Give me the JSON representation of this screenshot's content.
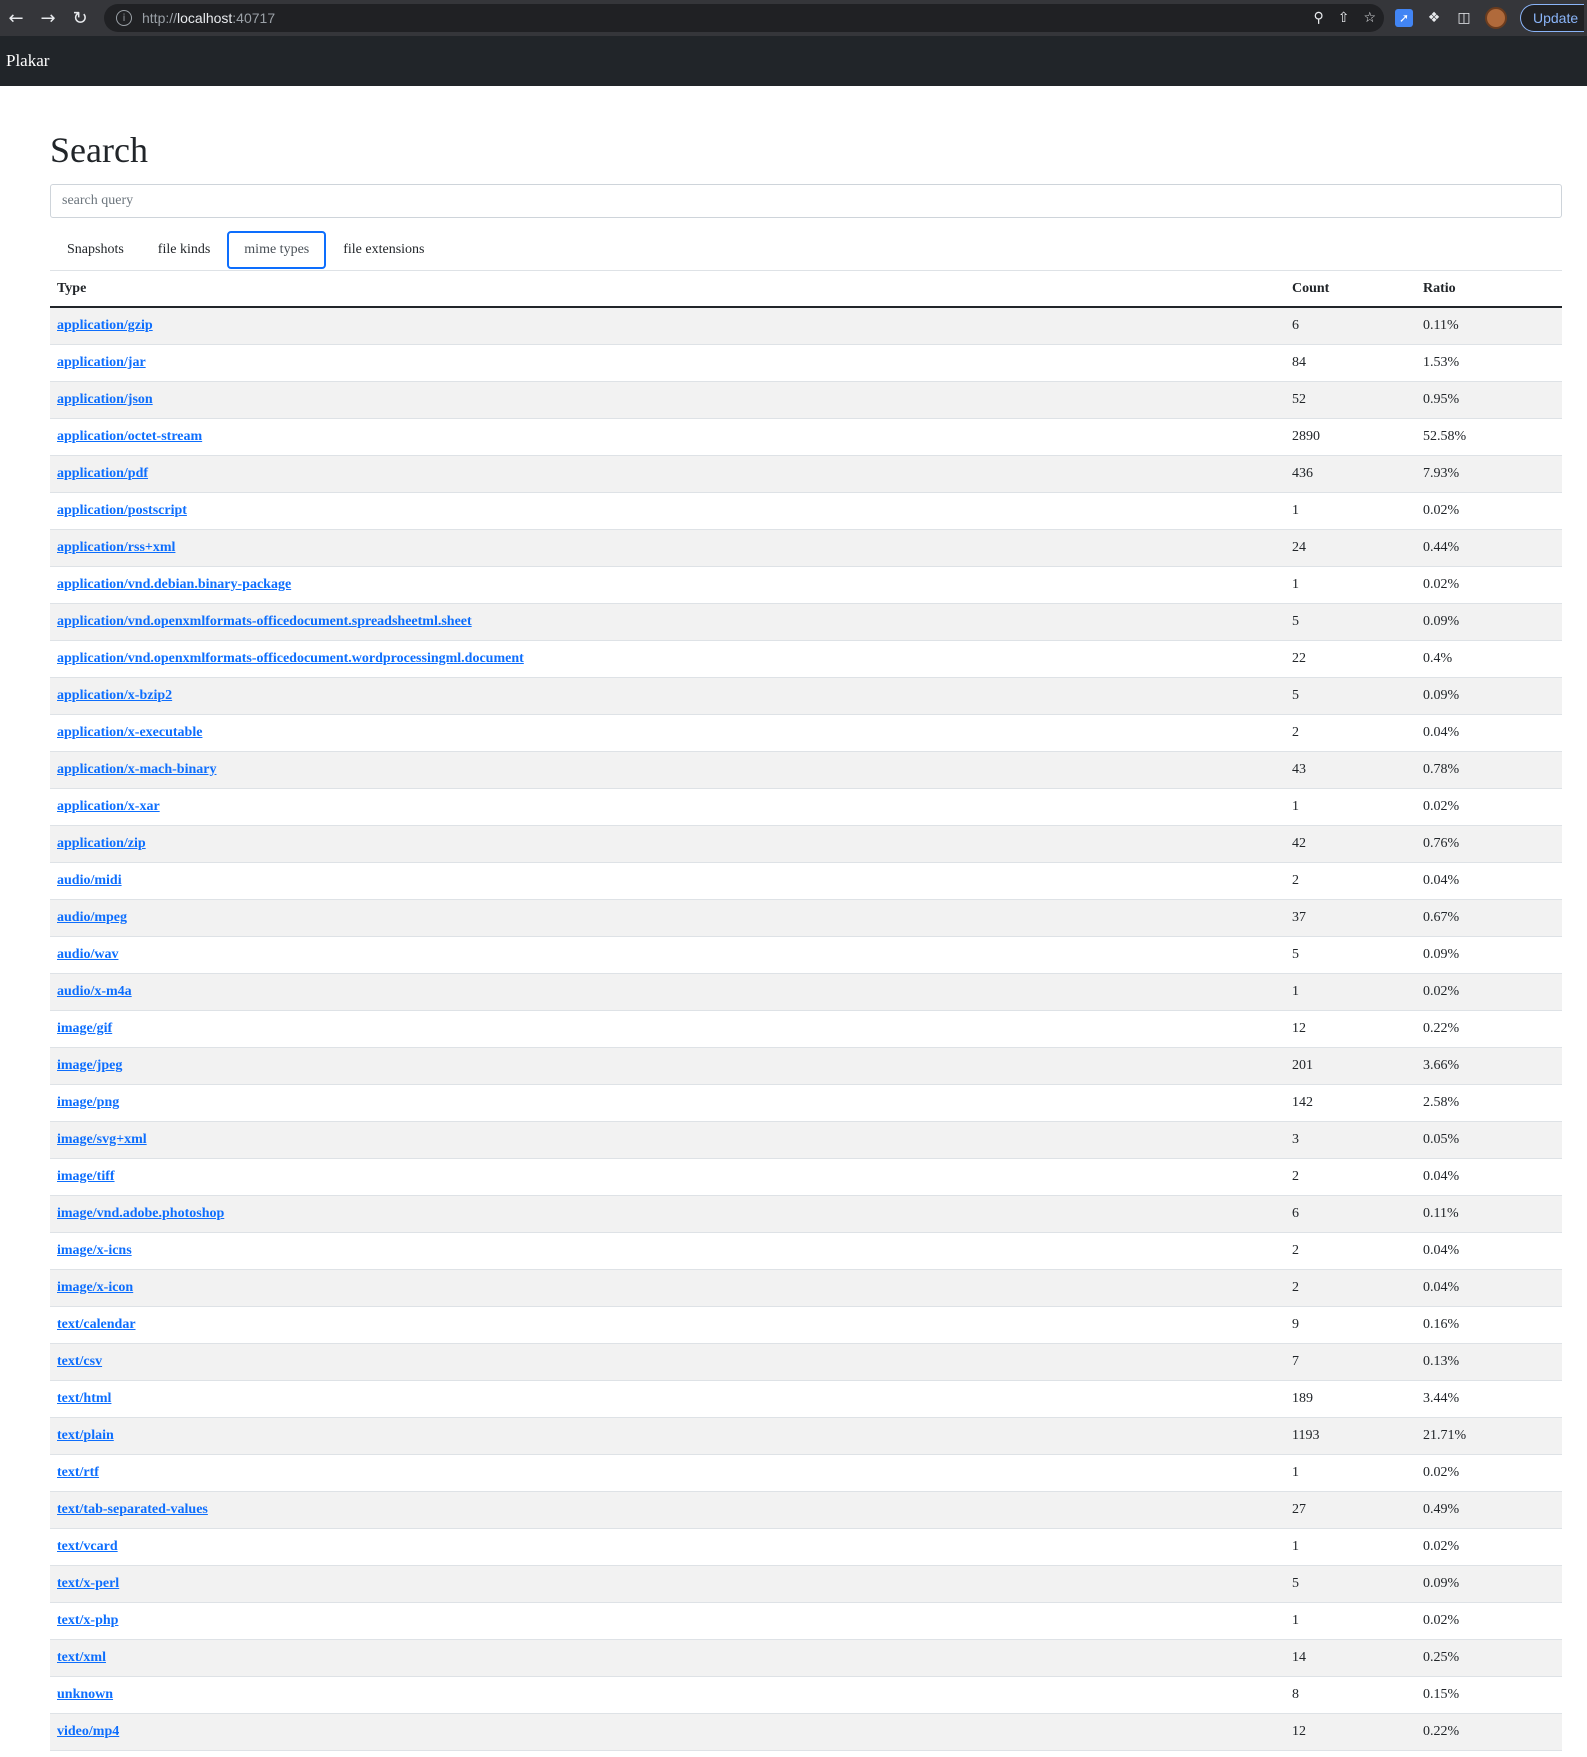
{
  "browser": {
    "url_scheme": "http://",
    "url_host": "localhost",
    "url_port": ":40717",
    "update_label": "Update"
  },
  "app": {
    "brand": "Plakar"
  },
  "page": {
    "title": "Search",
    "search_placeholder": "search query"
  },
  "tabs": [
    {
      "label": "Snapshots",
      "active": false
    },
    {
      "label": "file kinds",
      "active": false
    },
    {
      "label": "mime types",
      "active": true
    },
    {
      "label": "file extensions",
      "active": false
    }
  ],
  "table": {
    "headers": [
      "Type",
      "Count",
      "Ratio"
    ],
    "rows": [
      {
        "type": "application/gzip",
        "count": "6",
        "ratio": "0.11%"
      },
      {
        "type": "application/jar",
        "count": "84",
        "ratio": "1.53%"
      },
      {
        "type": "application/json",
        "count": "52",
        "ratio": "0.95%"
      },
      {
        "type": "application/octet-stream",
        "count": "2890",
        "ratio": "52.58%"
      },
      {
        "type": "application/pdf",
        "count": "436",
        "ratio": "7.93%"
      },
      {
        "type": "application/postscript",
        "count": "1",
        "ratio": "0.02%"
      },
      {
        "type": "application/rss+xml",
        "count": "24",
        "ratio": "0.44%"
      },
      {
        "type": "application/vnd.debian.binary-package",
        "count": "1",
        "ratio": "0.02%"
      },
      {
        "type": "application/vnd.openxmlformats-officedocument.spreadsheetml.sheet",
        "count": "5",
        "ratio": "0.09%"
      },
      {
        "type": "application/vnd.openxmlformats-officedocument.wordprocessingml.document",
        "count": "22",
        "ratio": "0.4%"
      },
      {
        "type": "application/x-bzip2",
        "count": "5",
        "ratio": "0.09%"
      },
      {
        "type": "application/x-executable",
        "count": "2",
        "ratio": "0.04%"
      },
      {
        "type": "application/x-mach-binary",
        "count": "43",
        "ratio": "0.78%"
      },
      {
        "type": "application/x-xar",
        "count": "1",
        "ratio": "0.02%"
      },
      {
        "type": "application/zip",
        "count": "42",
        "ratio": "0.76%"
      },
      {
        "type": "audio/midi",
        "count": "2",
        "ratio": "0.04%"
      },
      {
        "type": "audio/mpeg",
        "count": "37",
        "ratio": "0.67%"
      },
      {
        "type": "audio/wav",
        "count": "5",
        "ratio": "0.09%"
      },
      {
        "type": "audio/x-m4a",
        "count": "1",
        "ratio": "0.02%"
      },
      {
        "type": "image/gif",
        "count": "12",
        "ratio": "0.22%"
      },
      {
        "type": "image/jpeg",
        "count": "201",
        "ratio": "3.66%"
      },
      {
        "type": "image/png",
        "count": "142",
        "ratio": "2.58%"
      },
      {
        "type": "image/svg+xml",
        "count": "3",
        "ratio": "0.05%"
      },
      {
        "type": "image/tiff",
        "count": "2",
        "ratio": "0.04%"
      },
      {
        "type": "image/vnd.adobe.photoshop",
        "count": "6",
        "ratio": "0.11%"
      },
      {
        "type": "image/x-icns",
        "count": "2",
        "ratio": "0.04%"
      },
      {
        "type": "image/x-icon",
        "count": "2",
        "ratio": "0.04%"
      },
      {
        "type": "text/calendar",
        "count": "9",
        "ratio": "0.16%"
      },
      {
        "type": "text/csv",
        "count": "7",
        "ratio": "0.13%"
      },
      {
        "type": "text/html",
        "count": "189",
        "ratio": "3.44%"
      },
      {
        "type": "text/plain",
        "count": "1193",
        "ratio": "21.71%"
      },
      {
        "type": "text/rtf",
        "count": "1",
        "ratio": "0.02%"
      },
      {
        "type": "text/tab-separated-values",
        "count": "27",
        "ratio": "0.49%"
      },
      {
        "type": "text/vcard",
        "count": "1",
        "ratio": "0.02%"
      },
      {
        "type": "text/x-perl",
        "count": "5",
        "ratio": "0.09%"
      },
      {
        "type": "text/x-php",
        "count": "1",
        "ratio": "0.02%"
      },
      {
        "type": "text/xml",
        "count": "14",
        "ratio": "0.25%"
      },
      {
        "type": "unknown",
        "count": "8",
        "ratio": "0.15%"
      },
      {
        "type": "video/mp4",
        "count": "12",
        "ratio": "0.22%"
      }
    ]
  },
  "colors": {
    "link": "#0d6efd",
    "navbar": "#212529",
    "active_tab_border": "#0d6efd",
    "stripe": "#f2f2f2"
  }
}
